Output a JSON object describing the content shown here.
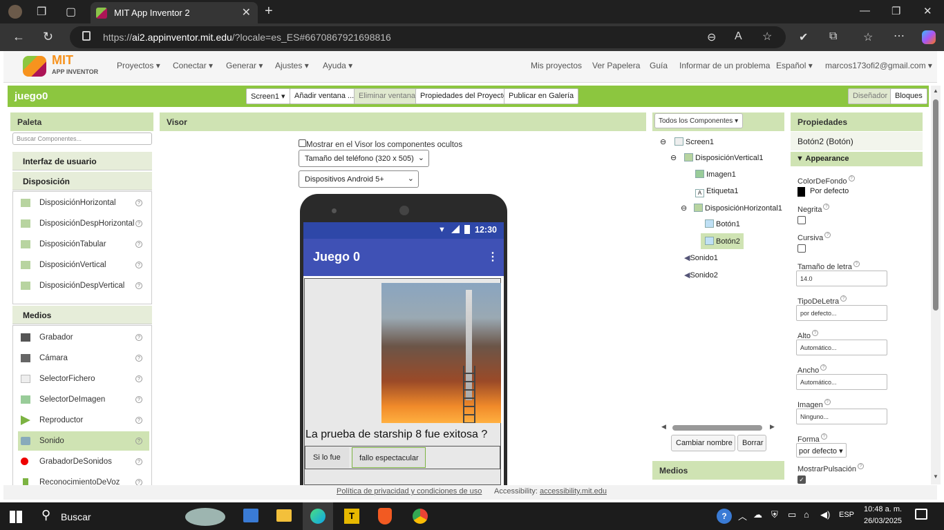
{
  "browser": {
    "tab_title": "MIT App Inventor 2",
    "url_host": "ai2.appinventor.mit.edu",
    "url_prefix": "https://",
    "url_rest": "/?locale=es_ES#6670867921698816"
  },
  "nav": {
    "logo_title": "MIT",
    "logo_subtitle": "APP INVENTOR",
    "menus": [
      "Proyectos",
      "Conectar",
      "Generar",
      "Ajustes",
      "Ayuda"
    ],
    "links": [
      "Mis proyectos",
      "Ver Papelera",
      "Guía",
      "Informar de un problema"
    ],
    "language": "Español",
    "account": "marcos173ofi2@gmail.com"
  },
  "project": {
    "name": "juego0",
    "screen_select": "Screen1",
    "add_screen": "Añadir ventana ...",
    "remove_screen": "Eliminar ventana",
    "project_props": "Propiedades del Proyecto",
    "publish": "Publicar en Galería",
    "designer": "Diseñador",
    "blocks": "Bloques"
  },
  "palette": {
    "title": "Paleta",
    "search_placeholder": "Buscar Componentes...",
    "sections": [
      "Interfaz de usuario",
      "Disposición",
      "Medios"
    ],
    "layout_items": [
      "DisposiciónHorizontal",
      "DisposiciónDespHorizontal",
      "DisposiciónTabular",
      "DisposiciónVertical",
      "DisposiciónDespVertical"
    ],
    "media_items": [
      "Grabador",
      "Cámara",
      "SelectorFichero",
      "SelectorDeImagen",
      "Reproductor",
      "Sonido",
      "GrabadorDeSonidos",
      "ReconocimientoDeVoz"
    ],
    "selected_item": "Sonido"
  },
  "viewer": {
    "title": "Visor",
    "show_hidden": "Mostrar en el Visor los componentes ocultos",
    "phone_size": "Tamaño del teléfono (320 x 505)",
    "android": "Dispositivos Android 5+",
    "status_time": "12:30",
    "app_title": "Juego 0",
    "label_text": "La prueba de starship 8 fue exitosa ?",
    "button1": "Si lo fue",
    "button2": "fallo espectacular"
  },
  "components": {
    "filter": "Todos los Componentes",
    "tree": [
      {
        "label": "Screen1",
        "level": 0,
        "toggle": "⊖"
      },
      {
        "label": "DisposiciónVertical1",
        "level": 1,
        "toggle": "⊖"
      },
      {
        "label": "Imagen1",
        "level": 2,
        "toggle": ""
      },
      {
        "label": "Etiqueta1",
        "level": 2,
        "toggle": ""
      },
      {
        "label": "DisposiciónHorizontal1",
        "level": 2,
        "toggle": "⊖"
      },
      {
        "label": "Botón1",
        "level": 3,
        "toggle": ""
      },
      {
        "label": "Botón2",
        "level": 3,
        "toggle": ""
      },
      {
        "label": "Sonido1",
        "level": 1,
        "toggle": ""
      },
      {
        "label": "Sonido2",
        "level": 1,
        "toggle": ""
      }
    ],
    "selected": "Botón2",
    "rename": "Cambiar nombre",
    "delete": "Borrar",
    "media_title": "Medios"
  },
  "properties": {
    "title": "Propiedades",
    "component": "Botón2 (Botón)",
    "group": "Appearance",
    "bg_label": "ColorDeFondo",
    "bg_value": "Por defecto",
    "bold_label": "Negrita",
    "italic_label": "Cursiva",
    "fontsize_label": "Tamaño de letra",
    "fontsize_value": "14.0",
    "fonttype_label": "TipoDeLetra",
    "fonttype_value": "por defecto...",
    "height_label": "Alto",
    "height_value": "Automático...",
    "width_label": "Ancho",
    "width_value": "Automático...",
    "image_label": "Imagen",
    "image_value": "Ninguno...",
    "shape_label": "Forma",
    "shape_value": "por defecto",
    "feedback_label": "MostrarPulsación",
    "feedback_checked": true
  },
  "footer": {
    "privacy": "Política de privacidad y condiciones de uso",
    "accessibility_label": "Accessibility:",
    "accessibility_link": "accessibility.mit.edu"
  },
  "taskbar": {
    "search": "Buscar",
    "lang": "ESP",
    "time": "10:48 a. m.",
    "date": "26/03/2025"
  }
}
